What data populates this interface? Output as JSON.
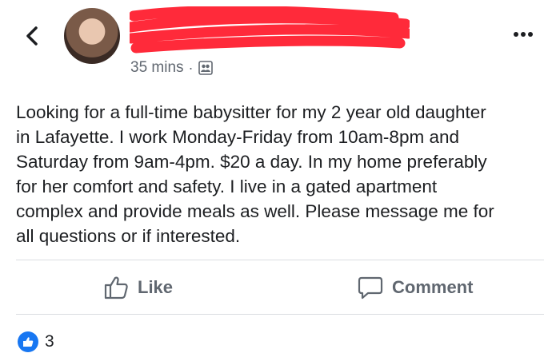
{
  "header": {
    "time": "35 mins",
    "separator": "·",
    "privacy_icon": "friends-privacy-icon",
    "back_icon": "back-chevron-icon",
    "more_icon": "more-dots-icon"
  },
  "post": {
    "text": "Looking for a full-time babysitter for my 2 year old daughter\nin Lafayette. I work Monday-Friday from 10am-8pm and\nSaturday from 9am-4pm. $20 a day. In my home preferably\nfor her comfort and safety. I live in a gated apartment\ncomplex and provide meals as well. Please message me for\nall questions or if interested."
  },
  "actions": {
    "like_label": "Like",
    "comment_label": "Comment"
  },
  "reactions": {
    "count": "3"
  },
  "colors": {
    "redaction": "#ff2a3a",
    "brand_blue": "#1877f2",
    "muted": "#606770"
  }
}
